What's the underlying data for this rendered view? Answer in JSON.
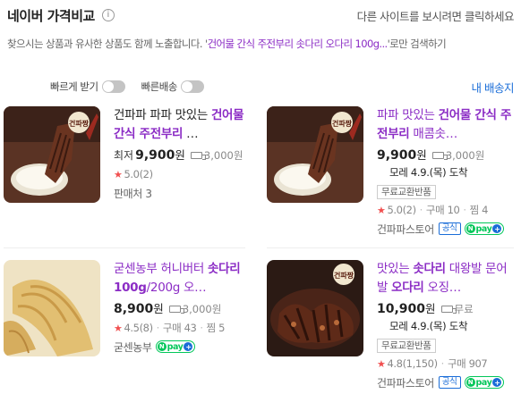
{
  "header": {
    "title": "네이버 가격비교",
    "info": "i",
    "right_text": "다른 사이트를 보시려면 클릭하세요"
  },
  "notice": {
    "prefix": "찾으시는 상품과 유사한 상품도 함께 노출합니다. '",
    "query": "건어물 간식 주전부리 솟다리 오다리 100g...",
    "suffix": "'로만 검색하기"
  },
  "filters": {
    "fast_receive": "빠르게 받기",
    "fast_delivery": "빠른배송"
  },
  "delivery_link": "내 배송지",
  "colors": {
    "title_purple": "#8b2cc5",
    "link_blue": "#1a6dd8",
    "npay_green": "#03c75a",
    "star_red": "#f14f4f"
  },
  "products": [
    {
      "title_parts": [
        {
          "text": "건파파 파파 맛있는 ",
          "bold": false
        },
        {
          "text": "건어물 간식 주전부리",
          "bold": true
        },
        {
          "text": " …",
          "bold": false
        }
      ],
      "price_prefix": "최저",
      "price": "9,900",
      "won": "원",
      "shipping": "3,000원",
      "rating": "5.0",
      "reviews": "(2)",
      "sellers": "판매처 3",
      "thumb_label": "건파짱"
    },
    {
      "title_parts": [
        {
          "text": "파파 맛있는 ",
          "bold": false
        },
        {
          "text": "건어물 간식 주전부리",
          "bold": true
        },
        {
          "text": " 매콤솟…",
          "bold": false
        }
      ],
      "price": "9,900",
      "won": "원",
      "shipping": "3,000원",
      "arrival_day": "모레 4.9.(목)",
      "arrival_text": "도착",
      "badge": "무료교환반품",
      "rating": "5.0",
      "reviews": "(2)",
      "purchases_label": "구매",
      "purchases": "10",
      "wish_label": "찜",
      "wish": "4",
      "seller": "건파파스토어",
      "official": "공식",
      "npay": "pay",
      "thumb_label": "건파짱"
    },
    {
      "title_parts": [
        {
          "text": "굳센농부 허니버터 ",
          "bold": false
        },
        {
          "text": "솟다리 100g",
          "bold": true
        },
        {
          "text": "/200g 오…",
          "bold": false
        }
      ],
      "price": "8,900",
      "won": "원",
      "shipping": "3,000원",
      "rating": "4.5",
      "reviews": "(8)",
      "purchases_label": "구매",
      "purchases": "43",
      "wish_label": "찜",
      "wish": "5",
      "seller": "굳센농부",
      "npay": "pay"
    },
    {
      "title_parts": [
        {
          "text": "맛있는 ",
          "bold": false
        },
        {
          "text": "솟다리",
          "bold": true
        },
        {
          "text": " 대왕발 문어발 ",
          "bold": false
        },
        {
          "text": "오다리",
          "bold": true
        },
        {
          "text": " 오징…",
          "bold": false
        }
      ],
      "price": "10,900",
      "won": "원",
      "shipping": "무료",
      "arrival_day": "모레 4.9.(목)",
      "arrival_text": "도착",
      "badge": "무료교환반품",
      "rating": "4.8",
      "reviews": "(1,150)",
      "purchases_label": "구매",
      "purchases": "907",
      "seller": "건파파스토어",
      "official": "공식",
      "npay": "pay",
      "thumb_label": "건파짱"
    }
  ]
}
